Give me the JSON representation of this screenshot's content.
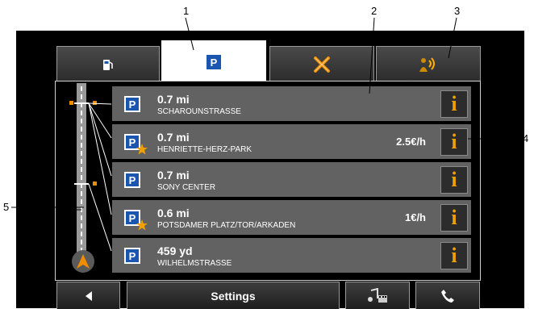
{
  "callouts": {
    "c1": "1",
    "c2": "2",
    "c3": "3",
    "c4": "4",
    "c5": "5"
  },
  "tabs": [
    {
      "name": "fuel",
      "icon": "fuel-pump-icon"
    },
    {
      "name": "parking",
      "icon": "parking-icon",
      "label": "P",
      "active": true
    },
    {
      "name": "restaurant",
      "icon": "cutlery-icon"
    },
    {
      "name": "traffic-info",
      "icon": "radio-person-icon"
    }
  ],
  "list": [
    {
      "distance": "0.7 mi",
      "street": "SCHAROUNSTRASSE",
      "icon": "parking-icon",
      "badge": "P",
      "price": ""
    },
    {
      "distance": "0.7 mi",
      "street": "HENRIETTE-HERZ-PARK",
      "icon": "parking-garage-star-icon",
      "badge": "P",
      "price": "2.5€/h"
    },
    {
      "distance": "0.7 mi",
      "street": "SONY CENTER",
      "icon": "parking-garage-icon",
      "badge": "P",
      "price": ""
    },
    {
      "distance": "0.6 mi",
      "street": "POTSDAMER PLATZ/TOR/ARKADEN",
      "icon": "parking-garage-star-icon",
      "badge": "P",
      "price": "1€/h"
    },
    {
      "distance": "459 yd",
      "street": "WILHELMSTRASSE",
      "icon": "parking-icon",
      "badge": "P",
      "price": ""
    }
  ],
  "info_label": "i",
  "bottom_bar": {
    "back_icon": "arrow-left-icon",
    "settings_label": "Settings",
    "music_icon": "music-video-icon",
    "phone_icon": "phone-icon"
  },
  "colors": {
    "parking_blue": "#1a56b0",
    "row_gray": "#626262",
    "info_orange": "#f0a000",
    "accent_orange": "#f08c00"
  }
}
